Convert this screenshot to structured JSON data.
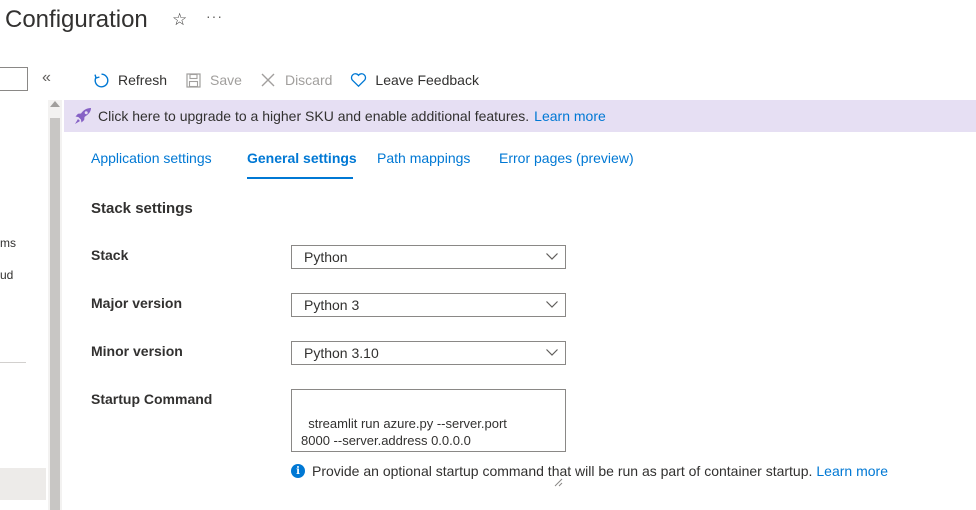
{
  "header": {
    "title": "Configuration",
    "star_glyph": "☆",
    "more_glyph": "···"
  },
  "left_nav": {
    "collapse_glyph": "«",
    "fragments": [
      "ms",
      "ud"
    ]
  },
  "toolbar": {
    "refresh_label": "Refresh",
    "save_label": "Save",
    "discard_label": "Discard",
    "feedback_label": "Leave Feedback"
  },
  "banner": {
    "text": "Click here to upgrade to a higher SKU and enable additional features.",
    "link": "Learn more",
    "background": "#e6dff3"
  },
  "tabs": [
    {
      "label": "Application settings",
      "active": false
    },
    {
      "label": "General settings",
      "active": true
    },
    {
      "label": "Path mappings",
      "active": false
    },
    {
      "label": "Error pages (preview)",
      "active": false
    }
  ],
  "stack_settings": {
    "title": "Stack settings",
    "stack": {
      "label": "Stack",
      "value": "Python"
    },
    "major_version": {
      "label": "Major version",
      "value": "Python 3"
    },
    "minor_version": {
      "label": "Minor version",
      "value": "Python 3.10"
    },
    "startup_command": {
      "label": "Startup Command",
      "value": "streamlit run azure.py --server.port\n8000 --server.address 0.0.0.0"
    },
    "info_text": "Provide an optional startup command that will be run as part of container startup.",
    "info_link": "Learn more"
  },
  "colors": {
    "accent": "#0078d4",
    "text": "#323130",
    "disabled": "#a19f9d"
  }
}
